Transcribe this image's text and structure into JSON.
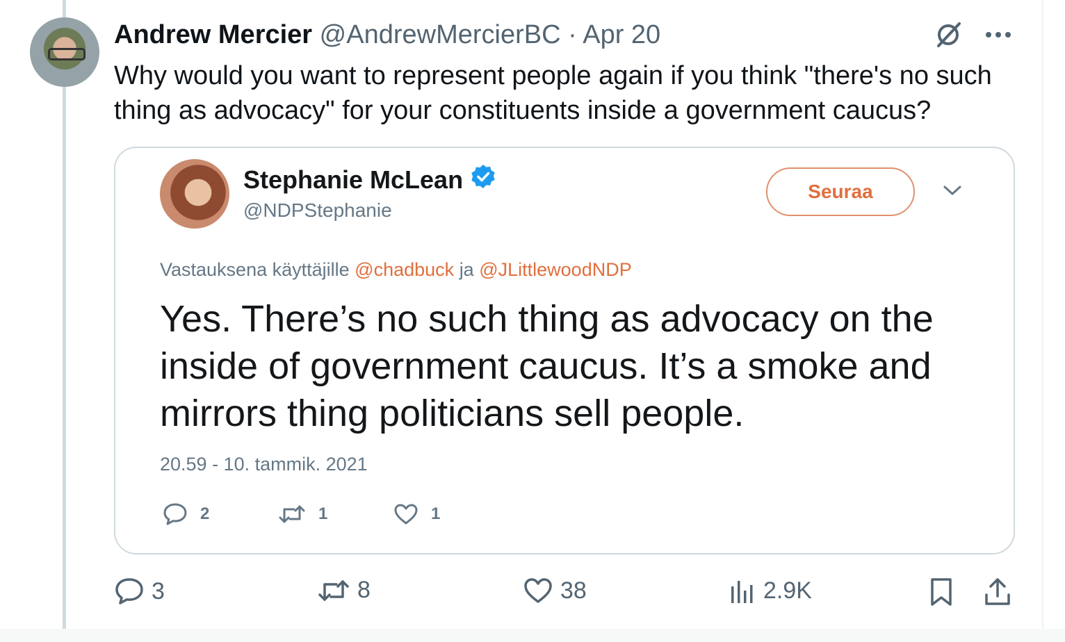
{
  "tweet": {
    "author_name": "Andrew Mercier",
    "author_handle": "@AndrewMercierBC",
    "separator": "·",
    "date": "Apr 20",
    "text": "Why would you want to represent people again if you think \"there's no such thing as advocacy\" for your constituents inside a government caucus?",
    "actions": {
      "replies": "3",
      "reposts": "8",
      "likes": "38",
      "views": "2.9K"
    }
  },
  "quoted": {
    "name": "Stephanie McLean",
    "handle": "@NDPStephanie",
    "follow_label": "Seuraa",
    "reply_prefix": "Vastauksena käyttäjille",
    "mention_1": "@chadbuck",
    "reply_join": "ja",
    "mention_2": "@JLittlewoodNDP",
    "text": "Yes. There’s no such thing as advocacy on the inside of government caucus. It’s a smoke and mirrors thing politicians sell people.",
    "timestamp": "20.59 - 10. tammik. 2021",
    "stats": {
      "replies": "2",
      "retweets": "1",
      "likes": "1"
    }
  },
  "colors": {
    "accent_orange": "#e06f3d",
    "verified_blue": "#1d9bf0",
    "muted": "#536471"
  },
  "icons": [
    "grok-icon",
    "more-icon",
    "verified-badge-icon",
    "chevron-down-icon",
    "reply-icon",
    "retweet-icon",
    "like-icon",
    "views-icon",
    "bookmark-icon",
    "share-icon"
  ]
}
